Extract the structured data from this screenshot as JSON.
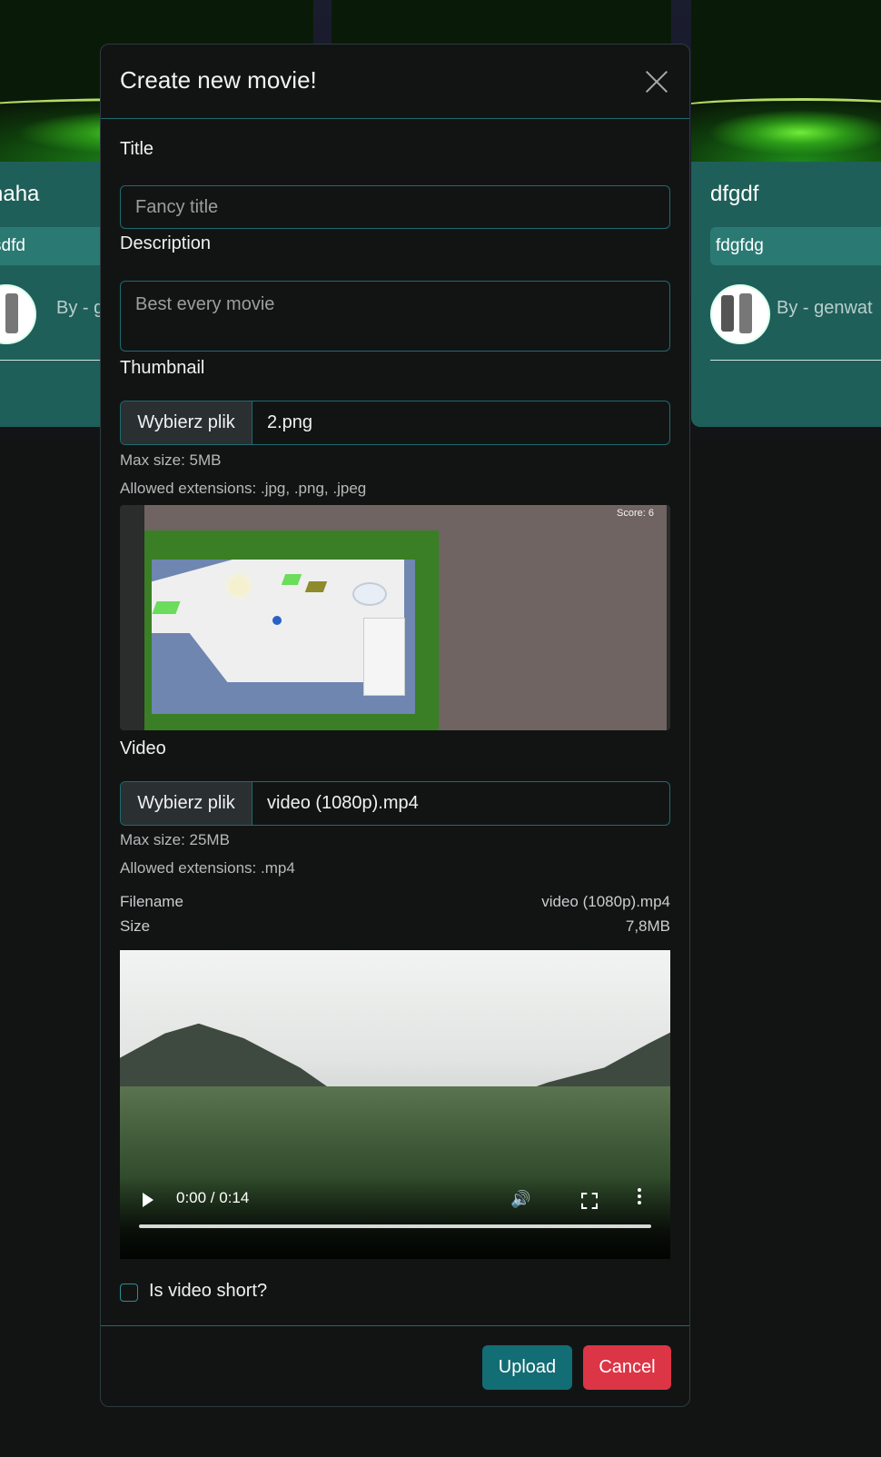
{
  "background_cards": [
    {
      "title": "haha",
      "tag": "sdfd",
      "byline": "By - g"
    },
    {
      "title": "",
      "tag": "",
      "byline": ""
    },
    {
      "title": "dfgdf",
      "tag": "fdgfdg",
      "byline": "By - genwat"
    }
  ],
  "modal": {
    "title": "Create new movie!",
    "fields": {
      "title_label": "Title",
      "title_placeholder": "Fancy title",
      "description_label": "Description",
      "description_placeholder": "Best every movie",
      "thumbnail_label": "Thumbnail",
      "thumbnail_button": "Wybierz plik",
      "thumbnail_filename": "2.png",
      "thumbnail_max_size": "Max size: 5MB",
      "thumbnail_allowed": "Allowed extensions: .jpg, .png, .jpeg",
      "thumbnail_preview_score": "Score: 6",
      "video_label": "Video",
      "video_button": "Wybierz plik",
      "video_filename": "video (1080p).mp4",
      "video_max_size": "Max size: 25MB",
      "video_allowed": "Allowed extensions: .mp4",
      "meta_filename_key": "Filename",
      "meta_filename_value": "video (1080p).mp4",
      "meta_size_key": "Size",
      "meta_size_value": "7,8MB",
      "video_time": "0:00 / 0:14",
      "short_label": "Is video short?"
    },
    "buttons": {
      "upload": "Upload",
      "cancel": "Cancel"
    }
  },
  "colors": {
    "accent": "#1f6a70",
    "upload": "#136d74",
    "cancel": "#dc3545",
    "card_bg": "#1f5f5a"
  },
  "icons": [
    "close-icon",
    "play-icon",
    "volume-icon",
    "fullscreen-icon",
    "more-options-icon"
  ]
}
